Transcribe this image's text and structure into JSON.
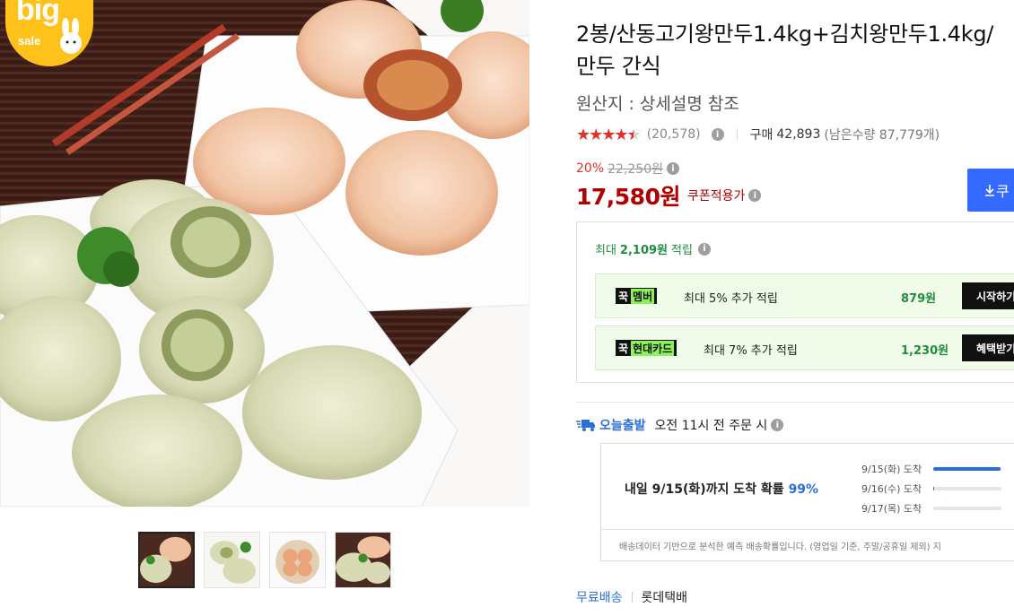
{
  "badge": {
    "big": "big",
    "sale": "sale"
  },
  "product": {
    "title": "2봉/산동고기왕만두1.4kg+김치왕만두1.4kg/만두 간식",
    "origin": "원산지 : 상세설명 참조"
  },
  "rating": {
    "score": 4.5,
    "review_count": "(20,578)",
    "buy_label": "구매",
    "buy_count": "42,893",
    "stock": "(남은수량 87,779개)"
  },
  "price": {
    "discount": "20%",
    "original": "22,250원",
    "final": "17,580원",
    "coupon_text": "쿠폰적용가",
    "coupon_button": "쿠"
  },
  "rewards": {
    "max_prefix": "최대",
    "max_amount": "2,109원",
    "max_suffix": "적립",
    "cards": [
      {
        "logo_prefix": "꾹",
        "logo_brand": "멤버",
        "desc": "최대 5% 추가 적립",
        "amount": "879원",
        "button": "시작하기"
      },
      {
        "logo_prefix": "꾹",
        "logo_brand": "현대카드",
        "desc": "최대 7% 추가 적립",
        "amount": "1,230원",
        "button": "혜택받기"
      }
    ]
  },
  "shipping": {
    "label": "오늘출발",
    "condition": "오전 11시 전 주문 시",
    "prediction": {
      "main_prefix": "내일 9/15(화)까지 도착 확률",
      "main_pct": "99%",
      "days": [
        {
          "label": "9/15(화) 도착",
          "prob": 0.99
        },
        {
          "label": "9/16(수) 도착",
          "prob": 0.01
        },
        {
          "label": "9/17(목) 도착",
          "prob": 0.0
        }
      ],
      "note": "배송데이터 기반으로 분석한 예측 배송확률입니다. (영업일 기준, 주말/공휴일 제외) 지"
    },
    "free": "무료배송",
    "carrier": "롯데택배"
  },
  "icons": {
    "info": "info-icon",
    "truck": "delivery-truck-icon",
    "download": "download-icon"
  },
  "colors": {
    "accent_blue": "#346aff",
    "price_red": "#ae0000",
    "reward_green": "#1e8e3e",
    "badge_yellow": "#ffc21a"
  }
}
